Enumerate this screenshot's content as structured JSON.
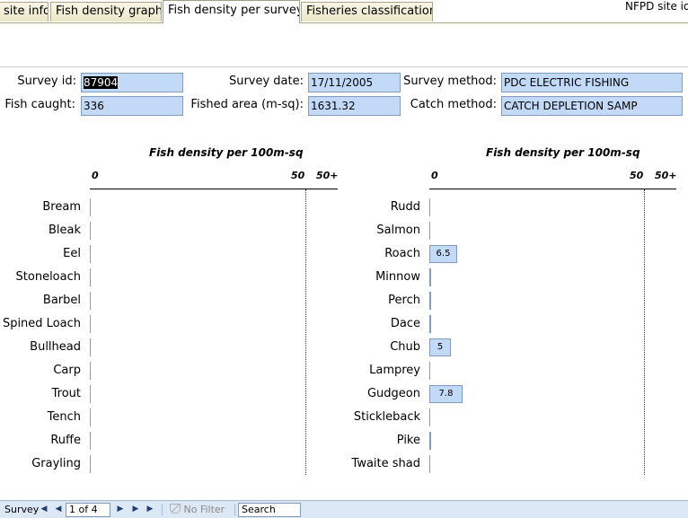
{
  "tabs": [
    {
      "label": "site info",
      "active": false
    },
    {
      "label": "Fish density graph",
      "active": false
    },
    {
      "label": "Fish density per survey",
      "active": true
    },
    {
      "label": "Fisheries classification",
      "active": false
    }
  ],
  "site_id_label": "NFPD site id",
  "survey": {
    "survey_id_label": "Survey id:",
    "survey_id": "87904",
    "fish_caught_label": "Fish caught:",
    "fish_caught": "336",
    "survey_date_label": "Survey date:",
    "survey_date": "17/11/2005",
    "fished_area_label": "Fished area (m-sq):",
    "fished_area": "1631.32",
    "survey_method_label": "Survey method:",
    "survey_method": "PDC ELECTRIC FISHING",
    "catch_method_label": "Catch method:",
    "catch_method": "CATCH DEPLETION SAMP"
  },
  "chart_data": [
    {
      "type": "bar",
      "orientation": "horizontal",
      "title": "Fish density per 100m-sq",
      "tick_labels": [
        "0",
        "50",
        "50+"
      ],
      "xlim": [
        0,
        50
      ],
      "categories": [
        "Bream",
        "Bleak",
        "Eel",
        "Stoneloach",
        "Barbel",
        "Spined Loach",
        "Bullhead",
        "Carp",
        "Trout",
        "Tench",
        "Ruffe",
        "Grayling"
      ],
      "values": [
        0,
        0,
        0,
        0,
        0,
        0,
        0,
        0,
        0,
        0,
        0,
        0
      ],
      "value_labels": [
        "",
        "",
        "",
        "",
        "",
        "",
        "",
        "",
        "",
        "",
        "",
        ""
      ]
    },
    {
      "type": "bar",
      "orientation": "horizontal",
      "title": "Fish density per 100m-sq",
      "tick_labels": [
        "0",
        "50",
        "50+"
      ],
      "xlim": [
        0,
        50
      ],
      "categories": [
        "Rudd",
        "Salmon",
        "Roach",
        "Minnow",
        "Perch",
        "Dace",
        "Chub",
        "Lamprey",
        "Gudgeon",
        "Stickleback",
        "Pike",
        "Twaite shad"
      ],
      "values": [
        0,
        0,
        6.5,
        0.1,
        0.1,
        0.1,
        5,
        0,
        7.8,
        0,
        0.4,
        0
      ],
      "value_labels": [
        "",
        "",
        "6.5",
        "",
        "",
        "",
        "5",
        "",
        "7.8",
        "",
        "",
        ""
      ]
    }
  ],
  "navbar": {
    "record_label": "Survey",
    "record_position": "1 of 4",
    "filter_label": "No Filter",
    "search_label": "Search",
    "first_glyph": "◀",
    "prev_glyph": "◀",
    "next_glyph": "▶",
    "last_glyph": "▶",
    "new_glyph": "▶"
  }
}
